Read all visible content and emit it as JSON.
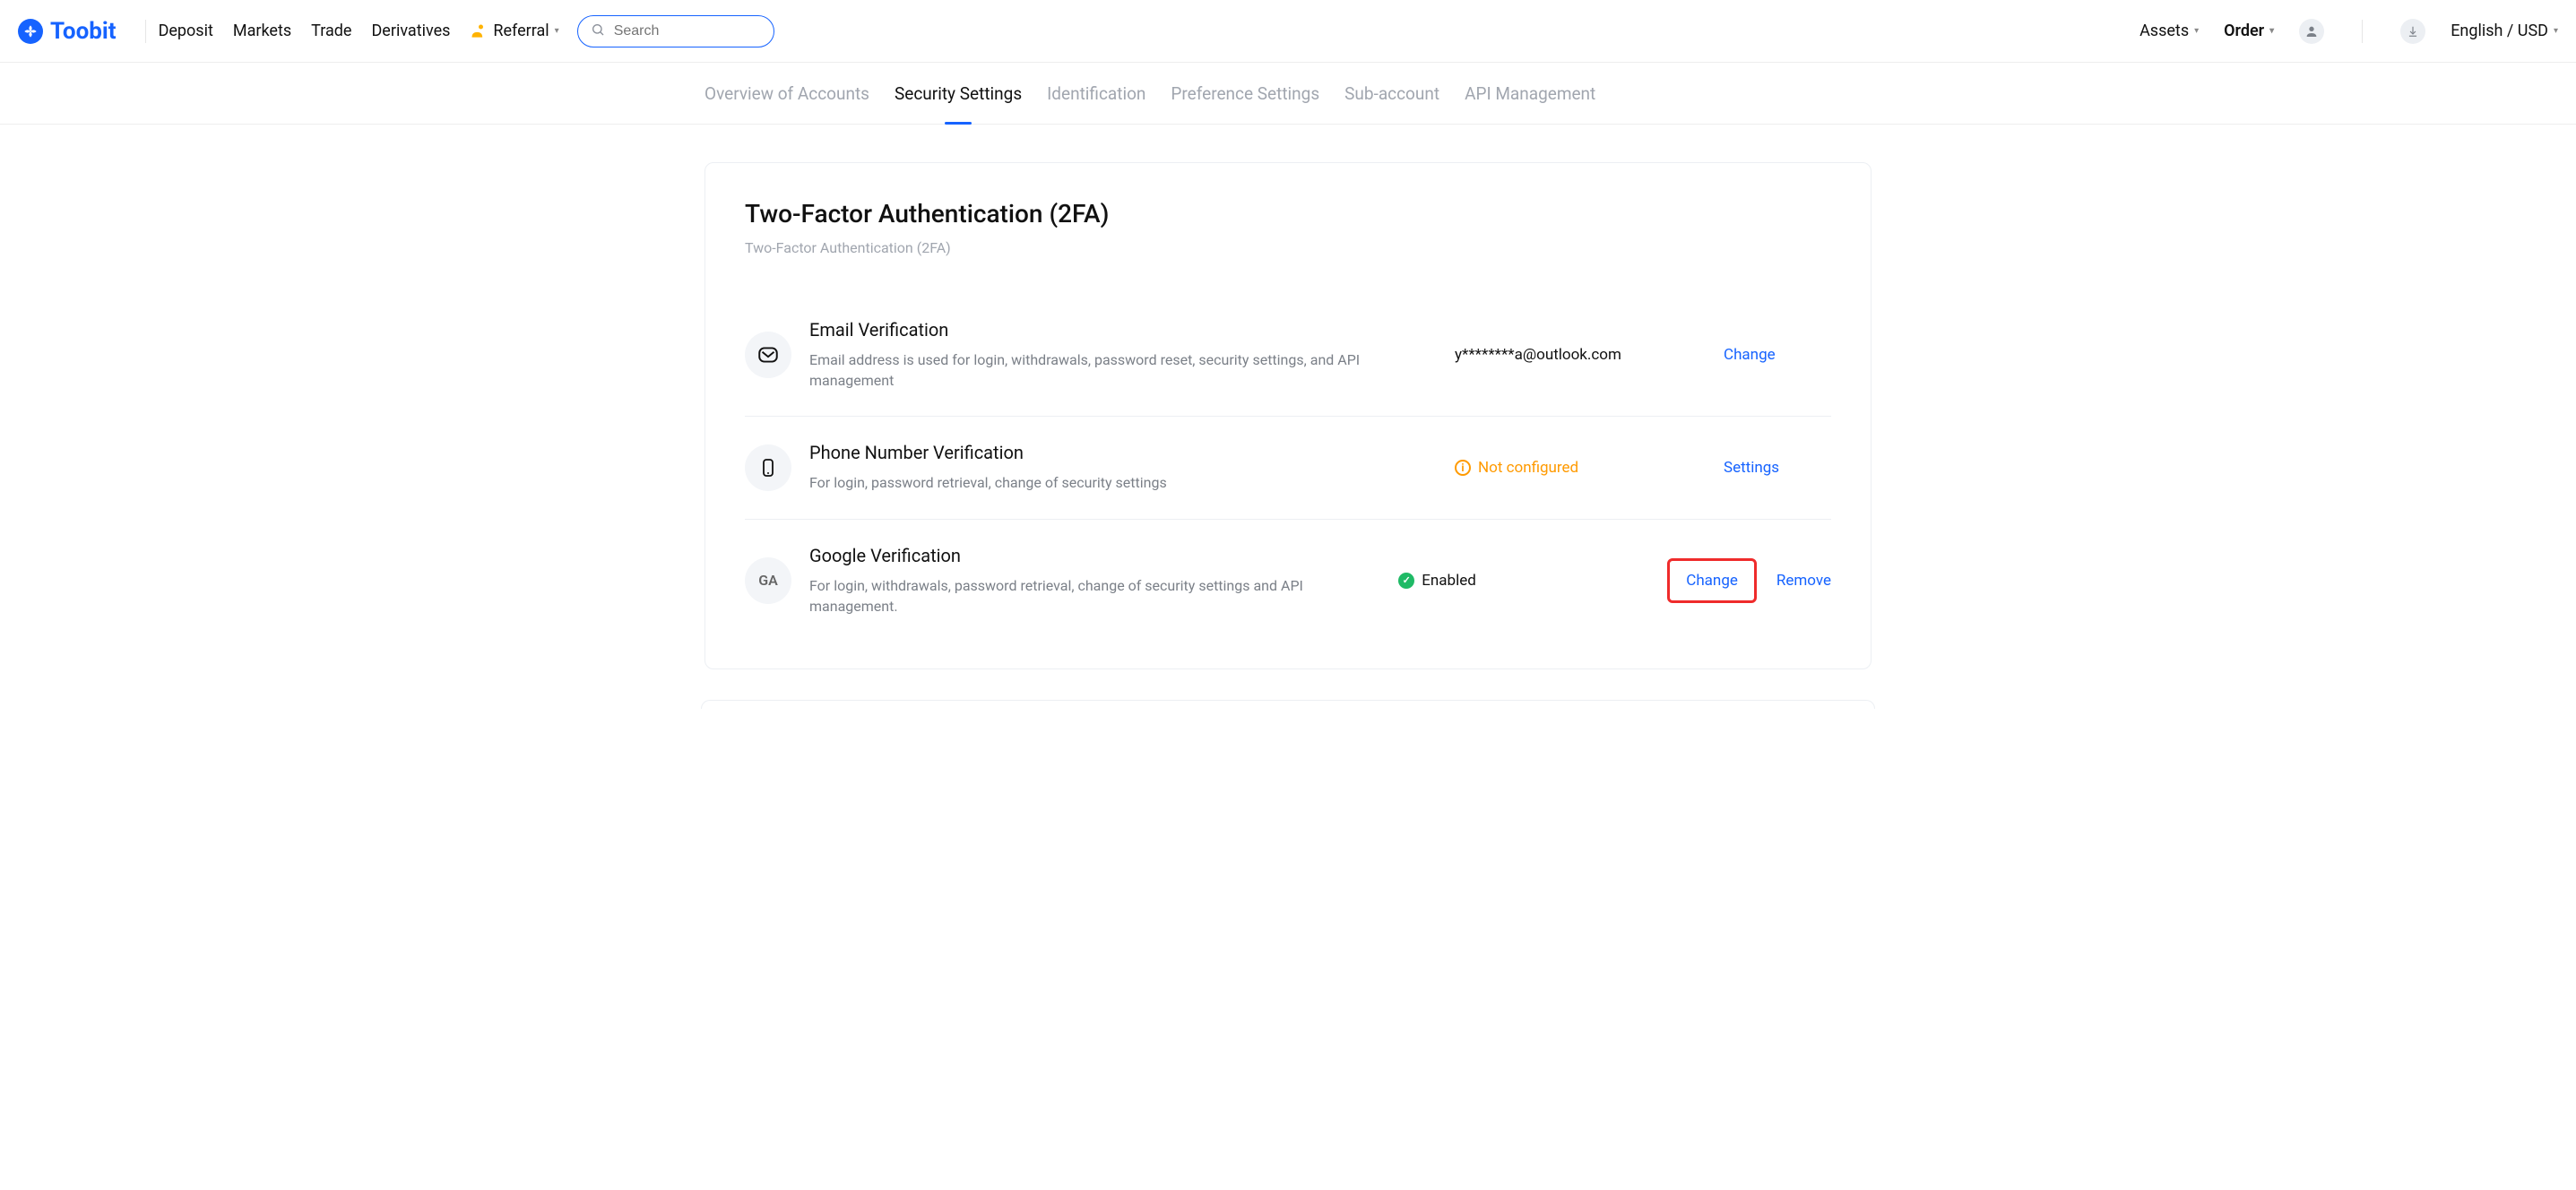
{
  "header": {
    "brand": "Toobit",
    "nav": [
      "Deposit",
      "Markets",
      "Trade",
      "Derivatives"
    ],
    "referral_label": "Referral",
    "search_placeholder": "Search",
    "assets_label": "Assets",
    "order_label": "Order",
    "lang_label": "English / USD"
  },
  "subnav": {
    "items": [
      "Overview of Accounts",
      "Security Settings",
      "Identification",
      "Preference Settings",
      "Sub-account",
      "API Management"
    ],
    "active_index": 1
  },
  "card": {
    "title": "Two-Factor Authentication (2FA)",
    "subtitle": "Two-Factor Authentication (2FA)"
  },
  "rows": {
    "email": {
      "title": "Email Verification",
      "desc": "Email address is used for login, withdrawals, password reset, security settings, and API management",
      "status_value": "y********a@outlook.com",
      "action_change": "Change"
    },
    "phone": {
      "title": "Phone Number Verification",
      "desc": "For login, password retrieval, change of security settings",
      "status_value": "Not configured",
      "action_settings": "Settings"
    },
    "google": {
      "title": "Google Verification",
      "desc": "For login, withdrawals, password retrieval, change of security settings and API management.",
      "status_value": "Enabled",
      "action_change": "Change",
      "action_remove": "Remove",
      "icon_text": "GA"
    }
  }
}
